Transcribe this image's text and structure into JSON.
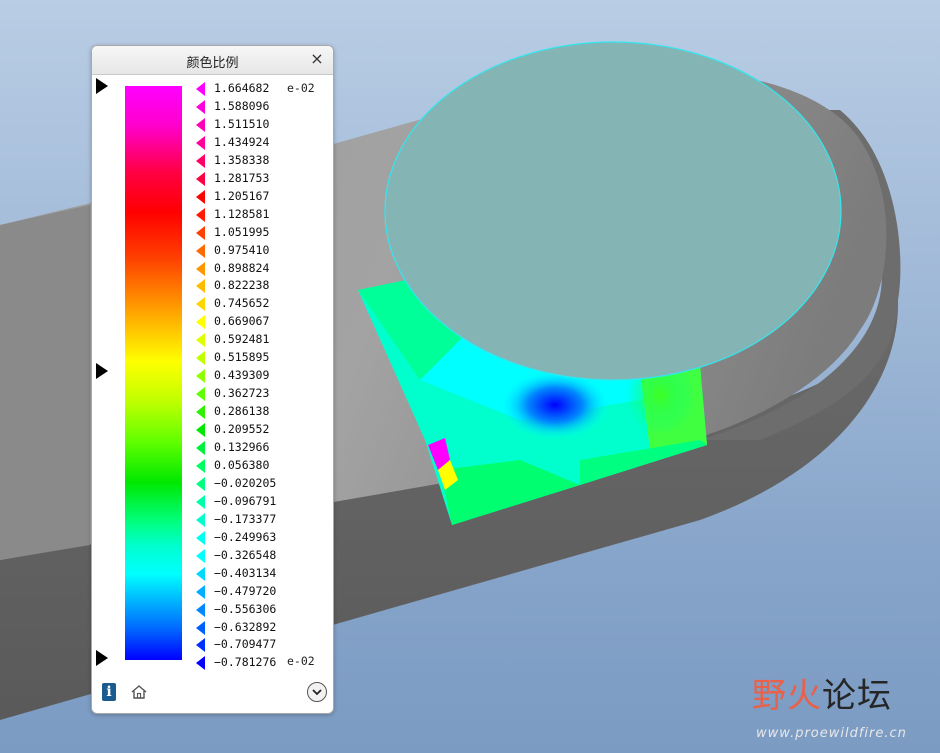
{
  "panel": {
    "title": "颜色比例",
    "close_glyph": "×",
    "exponent_top": "e-02",
    "exponent_bottom": "e-02",
    "ticks": [
      {
        "value": "1.664682",
        "color": "#ff00ff"
      },
      {
        "value": "1.588096",
        "color": "#ff00dd"
      },
      {
        "value": "1.511510",
        "color": "#ff00bb"
      },
      {
        "value": "1.434924",
        "color": "#ff0099"
      },
      {
        "value": "1.358338",
        "color": "#ff0066"
      },
      {
        "value": "1.281753",
        "color": "#ff0044"
      },
      {
        "value": "1.205167",
        "color": "#ff0000"
      },
      {
        "value": "1.128581",
        "color": "#ff1a00"
      },
      {
        "value": "1.051995",
        "color": "#ff4000"
      },
      {
        "value": "0.975410",
        "color": "#ff6a00"
      },
      {
        "value": "0.898824",
        "color": "#ff9500"
      },
      {
        "value": "0.822238",
        "color": "#ffbb00"
      },
      {
        "value": "0.745652",
        "color": "#ffd500"
      },
      {
        "value": "0.669067",
        "color": "#ffff00"
      },
      {
        "value": "0.592481",
        "color": "#ddff00"
      },
      {
        "value": "0.515895",
        "color": "#bfff00"
      },
      {
        "value": "0.439309",
        "color": "#90ff00"
      },
      {
        "value": "0.362723",
        "color": "#60ff00"
      },
      {
        "value": "0.286138",
        "color": "#30f000"
      },
      {
        "value": "0.209552",
        "color": "#00e800"
      },
      {
        "value": "0.132966",
        "color": "#00f040"
      },
      {
        "value": "0.056380",
        "color": "#00ff60"
      },
      {
        "value": "−0.020205",
        "color": "#00ff80"
      },
      {
        "value": "−0.096791",
        "color": "#00ffaa"
      },
      {
        "value": "−0.173377",
        "color": "#00ffcc"
      },
      {
        "value": "−0.249963",
        "color": "#00ffee"
      },
      {
        "value": "−0.326548",
        "color": "#00ffff"
      },
      {
        "value": "−0.403134",
        "color": "#00d8ff"
      },
      {
        "value": "−0.479720",
        "color": "#00b0ff"
      },
      {
        "value": "−0.556306",
        "color": "#0088ff"
      },
      {
        "value": "−0.632892",
        "color": "#0060ff"
      },
      {
        "value": "−0.709477",
        "color": "#0030ff"
      },
      {
        "value": "−0.781276",
        "color": "#0000ff"
      }
    ]
  },
  "watermark": {
    "cn_part1": "野火",
    "cn_part2": "论坛",
    "url": "www.proewildfire.cn"
  },
  "colors": {
    "part_gray": "#8f8f8f",
    "disc": "#84b4b4",
    "disc_edge": "#33e6ee"
  }
}
